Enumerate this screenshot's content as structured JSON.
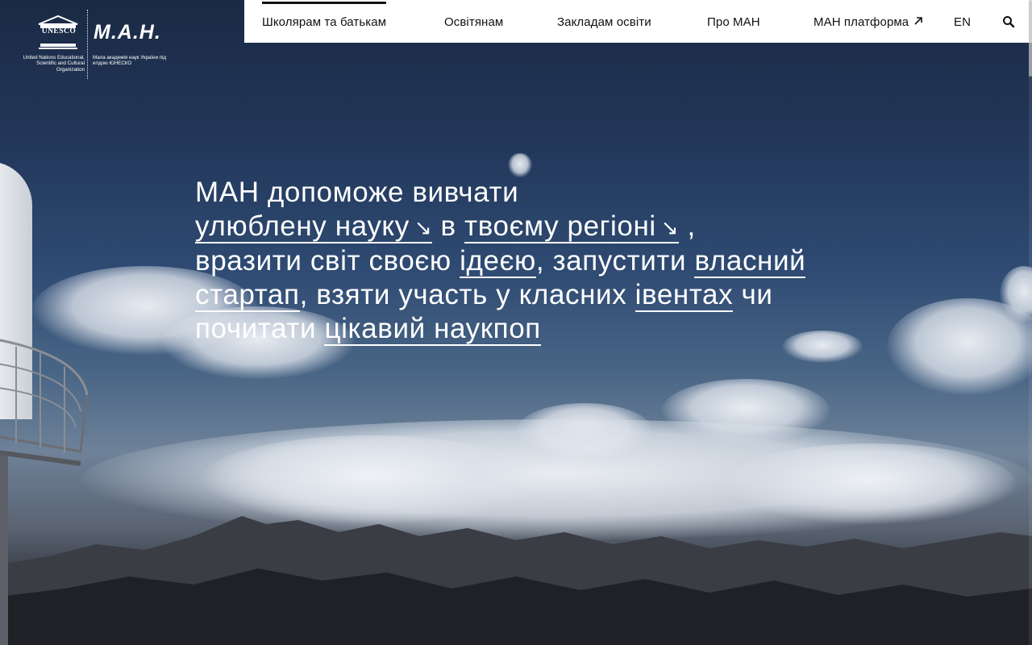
{
  "nav": {
    "items": [
      {
        "label": "Школярам та батькам",
        "active": true
      },
      {
        "label": "Освітянам"
      },
      {
        "label": "Закладам освіти"
      },
      {
        "label": "Про МАН"
      },
      {
        "label": "МАН платформа",
        "external_icon": "arrow-up-right-icon"
      },
      {
        "label": "EN"
      }
    ],
    "search_icon": "search-icon"
  },
  "logo": {
    "unesco_text": "UNESCO",
    "unesco_caption": "United Nations Educational, Scientific and Cultural Organization",
    "man_text": "М.А.Н.",
    "man_caption": "Мала академія наук України під егідою ЮНЕСКО"
  },
  "headline": {
    "intro": "МАН допоможе вивчати",
    "link_favorite_science": "улюблену науку",
    "word_in": "в",
    "link_your_region": "твоєму регіоні",
    "arrow_glyph": "↘",
    "comma": ",",
    "part_impress": "вразити світ своєю",
    "link_idea": "ідеєю",
    "part_launch": ", запустити",
    "link_own": "власний",
    "link_startup": "стартап",
    "part_join": ", взяти участь у класних",
    "link_events": "івентах",
    "part_or": "чи",
    "part_read": "почитати",
    "link_popsci": "цікавий наукпоп"
  },
  "colors": {
    "header_bg": "#ffffff",
    "nav_text": "#111111",
    "hero_text": "#ffffff"
  }
}
